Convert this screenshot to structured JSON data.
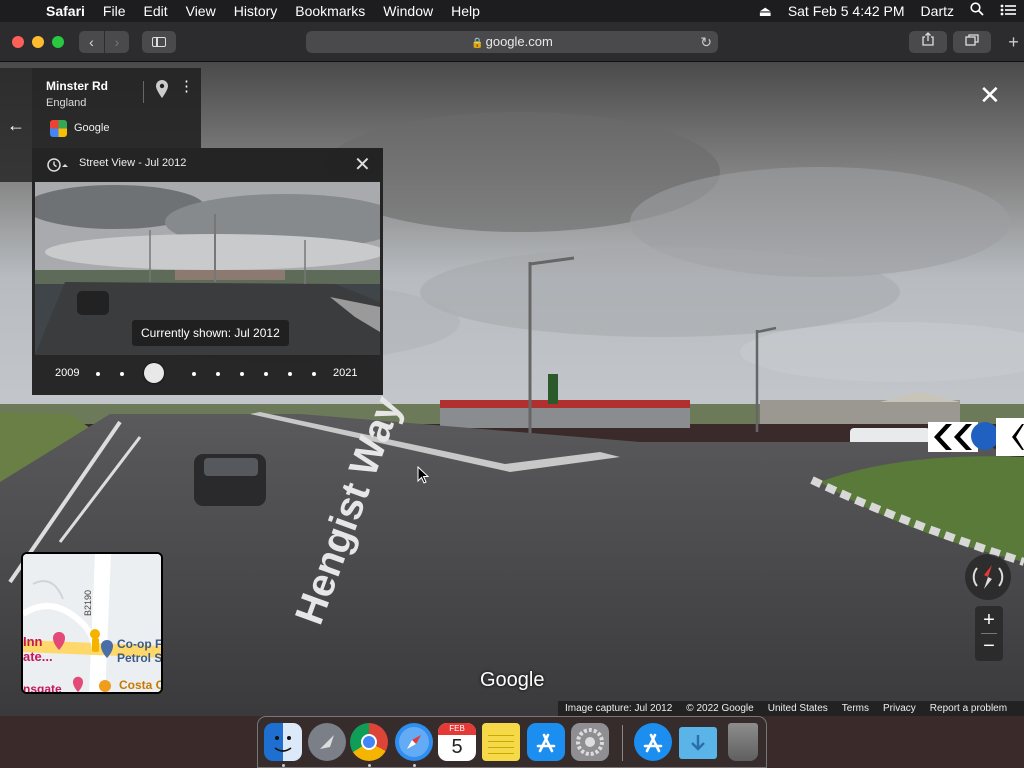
{
  "menubar": {
    "app_name": "Safari",
    "menus": [
      "File",
      "Edit",
      "View",
      "History",
      "Bookmarks",
      "Window",
      "Help"
    ],
    "datetime": "Sat Feb 5  4:42 PM",
    "user": "Dartz"
  },
  "browser": {
    "address": "google.com"
  },
  "info_card": {
    "title": "Minster Rd",
    "subtitle": "England",
    "source": "Google"
  },
  "time_machine": {
    "title": "Street View - Jul 2012",
    "tooltip": "Currently shown: Jul 2012",
    "start_year": "2009",
    "end_year": "2021",
    "dot_count": 10,
    "selected_index": 3
  },
  "scene": {
    "road_text": "Hengist Way",
    "watermark": "Google"
  },
  "minimap": {
    "road_label": "B2190",
    "labels": [
      "Inn",
      "ate...",
      "Co-op F",
      "Petrol S",
      "Costa C",
      "nsgate"
    ]
  },
  "footer": {
    "links": [
      "Image capture: Jul 2012",
      "© 2022 Google",
      "United States",
      "Terms",
      "Privacy",
      "Report a problem"
    ]
  },
  "dock": {
    "apps": [
      {
        "name": "finder-icon",
        "color": "#3b8fe8",
        "running": true
      },
      {
        "name": "launchpad-icon",
        "color": "#7a7f88",
        "running": false
      },
      {
        "name": "chrome-icon",
        "color": "#ffffff",
        "running": true
      },
      {
        "name": "safari-icon",
        "color": "#2f8ff0",
        "running": true
      },
      {
        "name": "calendar-icon",
        "color": "#ffffff",
        "running": false
      },
      {
        "name": "notes-icon",
        "color": "#f5d949",
        "running": false
      },
      {
        "name": "app-store-icon",
        "color": "#1c8ef0",
        "running": false
      },
      {
        "name": "system-preferences-icon",
        "color": "#8e8e93",
        "running": false
      },
      {
        "name": "app-store-downloads-icon",
        "color": "#1c8ef0",
        "running": false
      },
      {
        "name": "downloads-folder-icon",
        "color": "#5ab4e8",
        "running": false
      },
      {
        "name": "trash-icon",
        "color": "#9a9a9a",
        "running": false
      }
    ],
    "calendar_month": "FEB",
    "calendar_day": "5"
  }
}
